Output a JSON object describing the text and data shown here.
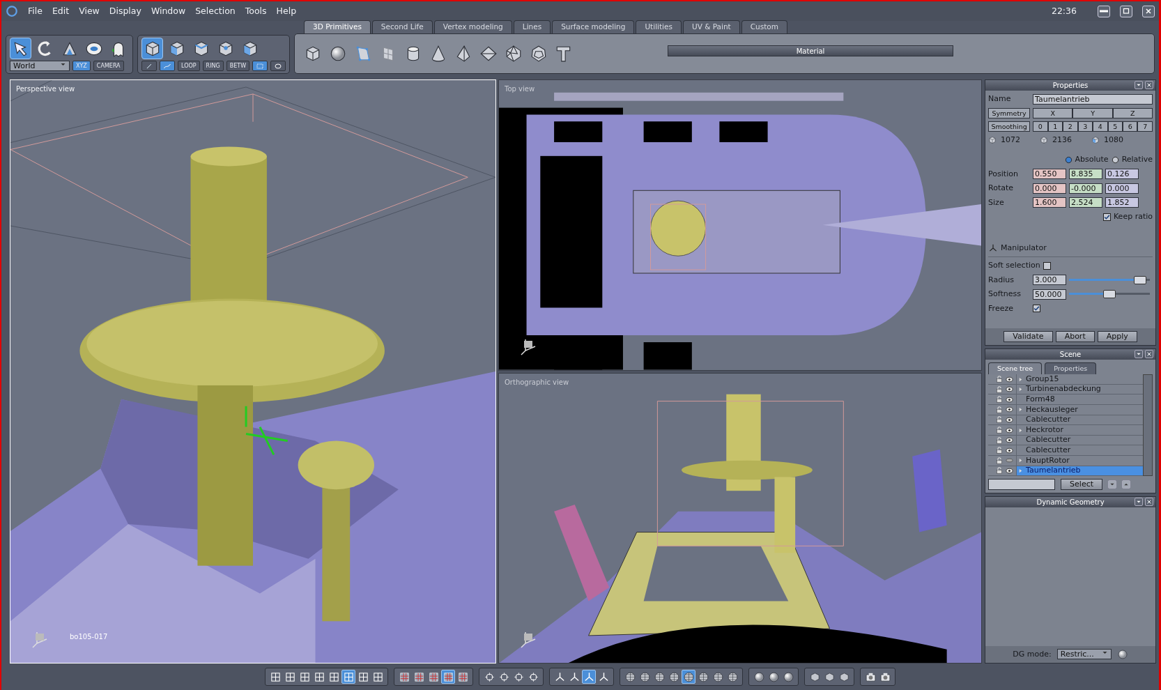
{
  "window": {
    "time": "22:36"
  },
  "menu": [
    "File",
    "Edit",
    "View",
    "Display",
    "Window",
    "Selection",
    "Tools",
    "Help"
  ],
  "tool_groups": [
    {
      "items": [
        {
          "kind": "arrow",
          "selected": true
        },
        {
          "kind": "rotate",
          "selected": false
        },
        {
          "kind": "scale",
          "selected": false
        },
        {
          "kind": "ring",
          "selected": false
        },
        {
          "kind": "ghost",
          "selected": false
        }
      ],
      "controls": [
        {
          "kind": "dropdown",
          "label": "World"
        },
        {
          "kind": "text",
          "label": "XYZ",
          "selected": true
        },
        {
          "kind": "text",
          "label": "CAMERA",
          "selected": false
        }
      ]
    },
    {
      "items": [
        {
          "kind": "cube",
          "selected": true
        },
        {
          "kind": "cube-face",
          "selected": false
        },
        {
          "kind": "cube-edge",
          "selected": false
        },
        {
          "kind": "cube-vertex",
          "selected": false
        },
        {
          "kind": "cube-face",
          "selected": false
        }
      ],
      "controls": [
        {
          "kind": "pen",
          "selected": false
        },
        {
          "kind": "path",
          "selected": true
        },
        {
          "kind": "text",
          "label": "LOOP",
          "selected": false
        },
        {
          "kind": "text",
          "label": "RING",
          "selected": false
        },
        {
          "kind": "text",
          "label": "BETW",
          "selected": false
        },
        {
          "kind": "rect",
          "selected": true
        },
        {
          "kind": "lasso",
          "selected": false
        }
      ]
    }
  ],
  "tabs": [
    {
      "label": "3D Primitives",
      "selected": true
    },
    {
      "label": "Second Life",
      "selected": false
    },
    {
      "label": "Vertex modeling",
      "selected": false
    },
    {
      "label": "Lines",
      "selected": false
    },
    {
      "label": "Surface modeling",
      "selected": false
    },
    {
      "label": "Utilities",
      "selected": false
    },
    {
      "label": "UV & Paint",
      "selected": false
    },
    {
      "label": "Custom",
      "selected": false
    }
  ],
  "primitives": [
    {
      "kind": "cube"
    },
    {
      "kind": "sphere"
    },
    {
      "kind": "polygon"
    },
    {
      "kind": "plane"
    },
    {
      "kind": "cylinder"
    },
    {
      "kind": "cone"
    },
    {
      "kind": "pyramid"
    },
    {
      "kind": "diamond"
    },
    {
      "kind": "gem"
    },
    {
      "kind": "dodeca"
    },
    {
      "kind": "tshape"
    }
  ],
  "material_bar": {
    "title": "Material"
  },
  "viewports": [
    {
      "title": "Perspective view",
      "active": true,
      "object_label": "bo105-017"
    },
    {
      "title": "Top view",
      "active": false
    },
    {
      "title": "Orthographic view",
      "active": false
    }
  ],
  "properties": {
    "title": "Properties",
    "name_label": "Name",
    "name": "Taumelantrieb",
    "symmetry": {
      "label": "Symmetry",
      "axes": [
        "X",
        "Y",
        "Z"
      ]
    },
    "smoothing": {
      "label": "Smoothing",
      "levels": [
        "0",
        "1",
        "2",
        "3",
        "4",
        "5",
        "6",
        "7"
      ]
    },
    "counts": [
      "1072",
      "2136",
      "1080"
    ],
    "modes": [
      {
        "label": "Absolute",
        "selected": true
      },
      {
        "label": "Relative",
        "selected": false
      }
    ],
    "transform": [
      {
        "label": "Position",
        "values": [
          "0.550",
          "8.835",
          "0.126"
        ]
      },
      {
        "label": "Rotate",
        "values": [
          "0.000",
          "-0.000",
          "0.000"
        ]
      },
      {
        "label": "Size",
        "values": [
          "1.600",
          "2.524",
          "1.852"
        ]
      }
    ],
    "keep_ratio": {
      "label": "Keep ratio",
      "checked": true
    },
    "manipulator": "Manipulator",
    "soft_selection": {
      "label": "Soft selection",
      "checked": false
    },
    "sliders": [
      {
        "label": "Radius",
        "value": "3.000",
        "level": 0.95
      },
      {
        "label": "Softness",
        "value": "50.000",
        "level": 0.5
      }
    ],
    "freeze": {
      "label": "Freeze",
      "checked": true
    },
    "buttons": [
      "Validate",
      "Abort",
      "Apply"
    ]
  },
  "scene": {
    "title": "Scene",
    "tabs": [
      {
        "label": "Scene tree",
        "selected": true
      },
      {
        "label": "Properties",
        "selected": false
      }
    ],
    "rows": [
      {
        "name": "Group15",
        "has_children": true,
        "visible": true,
        "selected": false
      },
      {
        "name": "Turbinenabdeckung",
        "has_children": true,
        "visible": true,
        "selected": false
      },
      {
        "name": "Form48",
        "has_children": false,
        "visible": true,
        "selected": false
      },
      {
        "name": "Heckausleger",
        "has_children": true,
        "visible": true,
        "selected": false
      },
      {
        "name": "Cablecutter",
        "has_children": false,
        "visible": true,
        "selected": false
      },
      {
        "name": "Heckrotor",
        "has_children": true,
        "visible": true,
        "selected": false
      },
      {
        "name": "Cablecutter",
        "has_children": false,
        "visible": true,
        "selected": false
      },
      {
        "name": "Cablecutter",
        "has_children": false,
        "visible": true,
        "selected": false
      },
      {
        "name": "HauptRotor",
        "has_children": true,
        "visible": false,
        "selected": false
      },
      {
        "name": "Taumelantrieb",
        "has_children": true,
        "visible": true,
        "selected": true
      }
    ],
    "select_button": "Select"
  },
  "dynamic_geometry": {
    "title": "Dynamic Geometry",
    "mode_label": "DG mode:",
    "mode": "Restric..."
  },
  "bottom_toolbar": [
    {
      "kind": "layout",
      "items": [
        {
          "selected": false
        },
        {
          "selected": false
        },
        {
          "selected": false
        },
        {
          "selected": false
        },
        {
          "selected": false
        },
        {
          "selected": true
        },
        {
          "selected": false
        },
        {
          "selected": false
        }
      ]
    },
    {
      "kind": "checker",
      "items": [
        {
          "selected": false
        },
        {
          "selected": false
        },
        {
          "selected": false
        },
        {
          "selected": true
        },
        {
          "selected": false
        }
      ]
    },
    {
      "kind": "view",
      "items": [
        {
          "selected": false
        },
        {
          "selected": false
        },
        {
          "selected": false
        },
        {
          "selected": false
        }
      ]
    },
    {
      "kind": "tool",
      "items": [
        {
          "selected": false
        },
        {
          "selected": false
        },
        {
          "selected": true
        },
        {
          "selected": false
        }
      ]
    },
    {
      "kind": "shading",
      "items": [
        {
          "selected": false
        },
        {
          "selected": false
        },
        {
          "selected": false
        },
        {
          "selected": false
        },
        {
          "selected": true
        },
        {
          "selected": false
        },
        {
          "selected": false
        },
        {
          "selected": false
        }
      ]
    },
    {
      "kind": "sphere",
      "items": [
        {
          "selected": false
        },
        {
          "selected": false
        },
        {
          "selected": false
        }
      ]
    },
    {
      "kind": "box",
      "items": [
        {
          "selected": false
        },
        {
          "selected": false
        },
        {
          "selected": false
        }
      ]
    },
    {
      "kind": "camera",
      "items": [
        {
          "selected": false
        },
        {
          "selected": false
        }
      ]
    }
  ]
}
